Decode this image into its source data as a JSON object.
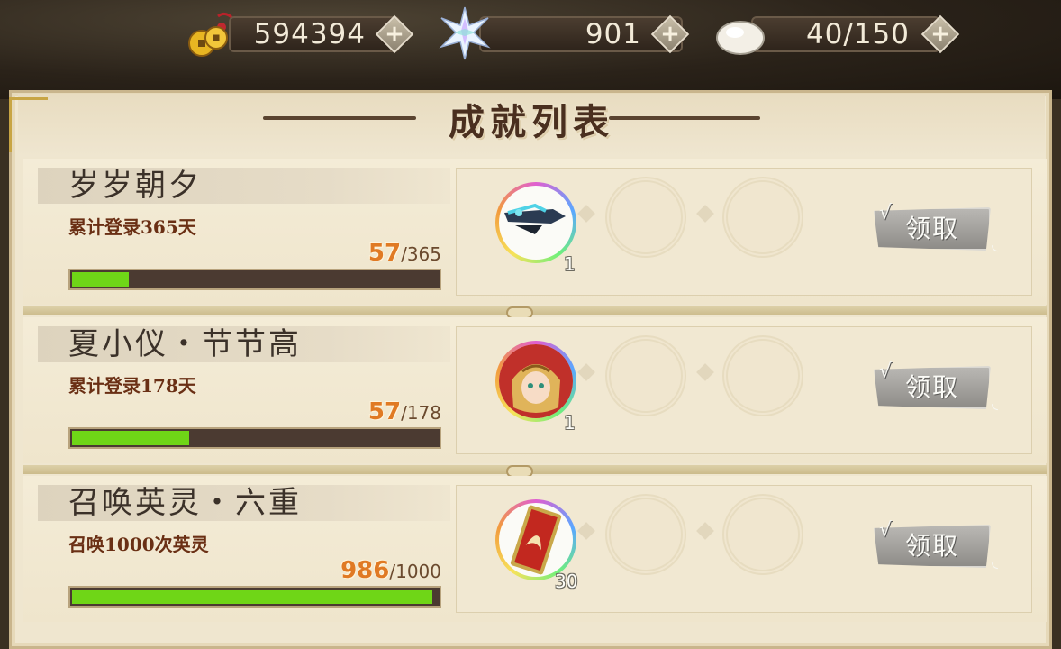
{
  "resources": {
    "coins": {
      "icon": "coins-icon",
      "value": "594394"
    },
    "crystal": {
      "icon": "crystal-star-icon",
      "value": "901"
    },
    "stamina": {
      "icon": "bun-icon",
      "value": "40/150"
    },
    "plus_label": "+"
  },
  "panel": {
    "title": "成就列表"
  },
  "achievements": [
    {
      "name": "岁岁朝夕",
      "description": "累计登录365天",
      "current": "57",
      "total": "365",
      "progress": 0.156,
      "reward": {
        "icon": "dragon-blade-icon",
        "count": "1"
      },
      "claim_label": "领取"
    },
    {
      "name": "夏小仪・节节高",
      "description": "累计登录178天",
      "current": "57",
      "total": "178",
      "progress": 0.32,
      "reward": {
        "icon": "hero-portrait-icon",
        "count": "1"
      },
      "claim_label": "领取"
    },
    {
      "name": "召唤英灵・六重",
      "description": "召唤1000次英灵",
      "current": "986",
      "total": "1000",
      "progress": 0.986,
      "reward": {
        "icon": "summon-card-icon",
        "count": "30"
      },
      "claim_label": "领取"
    }
  ],
  "colors": {
    "progress_fill": "#6fd617",
    "current_value": "#e07a24",
    "panel_bg": "#efe6cf"
  }
}
